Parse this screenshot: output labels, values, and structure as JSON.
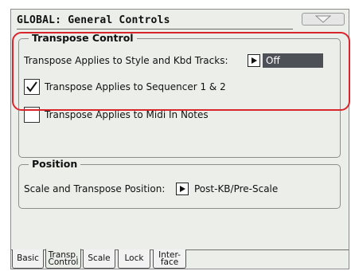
{
  "page": {
    "title": "GLOBAL: General Controls"
  },
  "transpose_control": {
    "group_title": "Transpose Control",
    "style_kbd_label": "Transpose Applies to Style and Kbd Tracks:",
    "style_kbd_value": "Off",
    "sequencer_label": "Transpose Applies to Sequencer 1 & 2",
    "sequencer_checked": true,
    "midi_in_label": "Transpose Applies to Midi In Notes",
    "midi_in_checked": false
  },
  "position": {
    "group_title": "Position",
    "label": "Scale and Transpose Position:",
    "value": "Post-KB/Pre-Scale"
  },
  "tabs": [
    {
      "line1": "Basic",
      "line2": "",
      "active": false
    },
    {
      "line1": "Transp.",
      "line2": "Control",
      "active": true
    },
    {
      "line1": "Scale",
      "line2": "",
      "active": false
    },
    {
      "line1": "Lock",
      "line2": "",
      "active": false
    },
    {
      "line1": "Inter-",
      "line2": "face",
      "active": false
    }
  ],
  "colors": {
    "highlight": "#d9262c",
    "screen_bg": "#eceeea",
    "value_field_bg": "#4e5058"
  }
}
